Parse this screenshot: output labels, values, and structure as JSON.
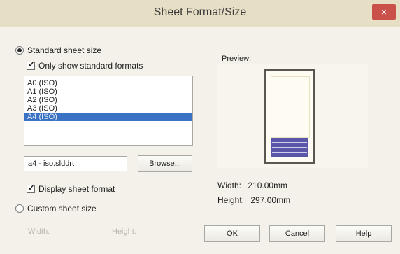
{
  "window": {
    "title": "Sheet Format/Size",
    "close_glyph": "×"
  },
  "standard": {
    "radio_label": "Standard sheet size",
    "checked": true
  },
  "only_standard": {
    "label": "Only show standard formats",
    "checked": true
  },
  "formats": [
    {
      "label": "A0 (ISO)",
      "selected": false
    },
    {
      "label": "A1 (ISO)",
      "selected": false
    },
    {
      "label": "A2 (ISO)",
      "selected": false
    },
    {
      "label": "A3 (ISO)",
      "selected": false
    },
    {
      "label": "A4 (ISO)",
      "selected": true
    }
  ],
  "format_file": {
    "value": "a4 - iso.slddrt"
  },
  "browse_label": "Browse...",
  "display_format": {
    "label": "Display sheet format",
    "checked": true
  },
  "custom": {
    "radio_label": "Custom sheet size",
    "checked": false,
    "width_label": "Width:",
    "height_label": "Height:"
  },
  "preview": {
    "label": "Preview:",
    "width_label": "Width:",
    "width_value": "210.00mm",
    "height_label": "Height:",
    "height_value": "297.00mm"
  },
  "buttons": {
    "ok": "OK",
    "cancel": "Cancel",
    "help": "Help"
  },
  "colors": {
    "selection": "#3a73c4",
    "close": "#c9514a",
    "title_block": "#5a56a8"
  }
}
